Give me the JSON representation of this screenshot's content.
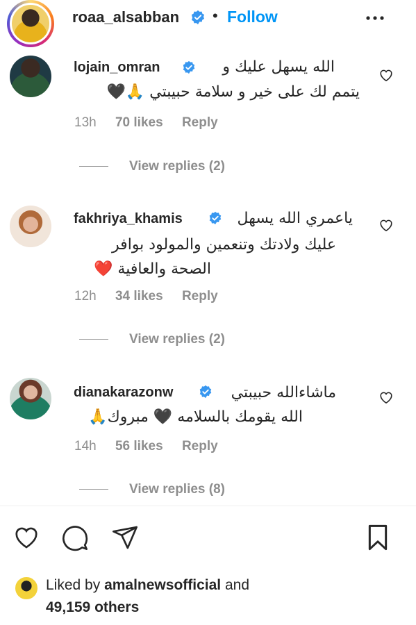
{
  "header": {
    "username": "roaa_alsabban",
    "separator": "•",
    "follow_label": "Follow",
    "more_icon": "more-horizontal-icon"
  },
  "comments": [
    {
      "username": "lojain_omran",
      "line1": "الله يسهل عليك و",
      "line2": "يتمم لك على خير و سلامة حبيبتي 🙏🖤",
      "time": "13h",
      "likes": "70 likes",
      "reply_label": "Reply",
      "view_replies": "View replies (2)"
    },
    {
      "username": "fakhriya_khamis",
      "line1": "ياعمري الله يسهل",
      "line2": "عليك ولادتك وتنعمين والمولود بوافر",
      "line3": "الصحة والعافية ❤️",
      "time": "12h",
      "likes": "34 likes",
      "reply_label": "Reply",
      "view_replies": "View replies (2)"
    },
    {
      "username": "dianakarazonw",
      "line1": "ماشاءالله حبيبتي",
      "line2": "الله يقومك بالسلامه 🖤 مبروك🙏",
      "time": "14h",
      "likes": "56 likes",
      "reply_label": "Reply",
      "view_replies": "View replies (8)"
    }
  ],
  "liked_by": {
    "prefix": "Liked by ",
    "user": "amalnewsofficial",
    "suffix": " and",
    "others": "49,159 others"
  },
  "colors": {
    "accent": "#0095f6",
    "verified": "#3897f0",
    "muted": "#8e8e8e",
    "text": "#262626"
  }
}
